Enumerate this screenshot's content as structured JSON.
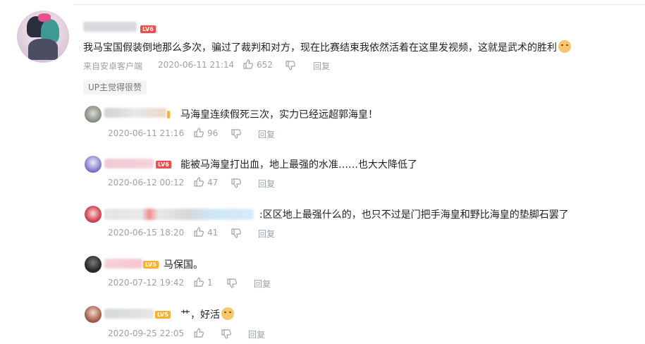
{
  "main_comment": {
    "text": "我马宝国假装倒地那么多次，骗过了裁判和对方，现在比赛结束我依然活着在这里发视频，这就是武术的胜利",
    "level": "LV6",
    "platform": "来自安卓客户端",
    "date": "2020-06-11 21:14",
    "likes": "652",
    "reply_label": "回复",
    "tag": "UP主觉得很赞"
  },
  "replies": [
    {
      "text": "马海皇连续假死三次，实力已经远超郭海皇！",
      "level": "",
      "date": "2020-06-11 21:16",
      "likes": "96",
      "reply_label": "回复"
    },
    {
      "text": "能被马海皇打出血，地上最强的水准……也大大降低了",
      "level": "LV6",
      "date": "2020-06-12 00:12",
      "likes": "47",
      "reply_label": "回复"
    },
    {
      "text": ":区区地上最强什么的，也只不过是门把手海皇和野比海皇的垫脚石罢了",
      "level": "",
      "date": "2020-06-15 18:20",
      "likes": "41",
      "reply_label": "回复"
    },
    {
      "text": "马保国。",
      "level": "LV5",
      "date": "2020-07-12 19:42",
      "likes": "1",
      "reply_label": "回复"
    },
    {
      "text": "艹，好活",
      "level": "LV5",
      "date": "2020-09-25 22:05",
      "likes": "",
      "reply_label": "回复"
    }
  ],
  "icons": {
    "like": "thumbs-up-icon",
    "dislike": "thumbs-down-icon",
    "emoji": "cat-face-emoji-icon"
  },
  "colors": {
    "meta_gray": "#99a2aa",
    "level_red": "#f04c49",
    "level_orange": "#ffb027"
  }
}
